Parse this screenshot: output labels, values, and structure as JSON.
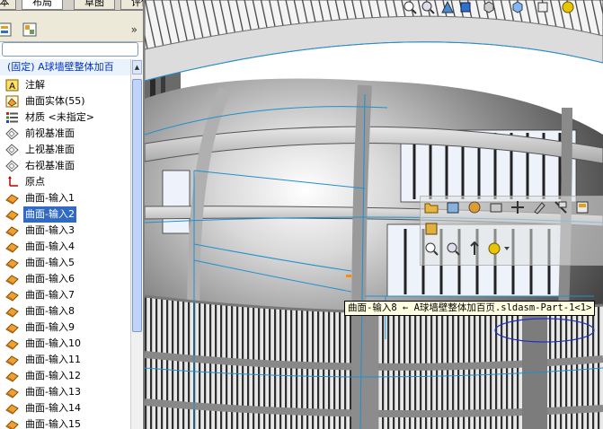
{
  "tabs": [
    {
      "label": "本",
      "active": false
    },
    {
      "label": "布局",
      "active": true
    },
    {
      "label": "草图",
      "active": false
    },
    {
      "label": "评估",
      "active": false
    }
  ],
  "panel": {
    "chevron": "»",
    "root_item": "(固定) A球墙壁整体加百",
    "items": [
      {
        "label": "注解",
        "icon": "annotation-icon"
      },
      {
        "label": "曲面实体(55)",
        "icon": "surface-bodies-icon"
      },
      {
        "label": "材质 <未指定>",
        "icon": "material-icon"
      },
      {
        "label": "前视基准面",
        "icon": "plane-icon"
      },
      {
        "label": "上视基准面",
        "icon": "plane-icon"
      },
      {
        "label": "右视基准面",
        "icon": "plane-icon"
      },
      {
        "label": "原点",
        "icon": "origin-icon"
      },
      {
        "label": "曲面-输入1",
        "icon": "surface-import-icon"
      },
      {
        "label": "曲面-输入2",
        "icon": "surface-import-icon",
        "selected": true
      },
      {
        "label": "曲面-输入3",
        "icon": "surface-import-icon"
      },
      {
        "label": "曲面-输入4",
        "icon": "surface-import-icon"
      },
      {
        "label": "曲面-输入5",
        "icon": "surface-import-icon"
      },
      {
        "label": "曲面-输入6",
        "icon": "surface-import-icon"
      },
      {
        "label": "曲面-输入7",
        "icon": "surface-import-icon"
      },
      {
        "label": "曲面-输入8",
        "icon": "surface-import-icon"
      },
      {
        "label": "曲面-输入9",
        "icon": "surface-import-icon"
      },
      {
        "label": "曲面-输入10",
        "icon": "surface-import-icon"
      },
      {
        "label": "曲面-输入11",
        "icon": "surface-import-icon"
      },
      {
        "label": "曲面-输入12",
        "icon": "surface-import-icon"
      },
      {
        "label": "曲面-输入13",
        "icon": "surface-import-icon"
      },
      {
        "label": "曲面-输入14",
        "icon": "surface-import-icon"
      },
      {
        "label": "曲面-输入15",
        "icon": "surface-import-icon"
      }
    ]
  },
  "tooltip": "曲面-输入8 ← A球墙壁整体加百页.sldasm-Part-1<1>",
  "colors": {
    "selection": "#316ac5",
    "edge_highlight": "#1e90d0",
    "root_text": "#0033cc"
  }
}
